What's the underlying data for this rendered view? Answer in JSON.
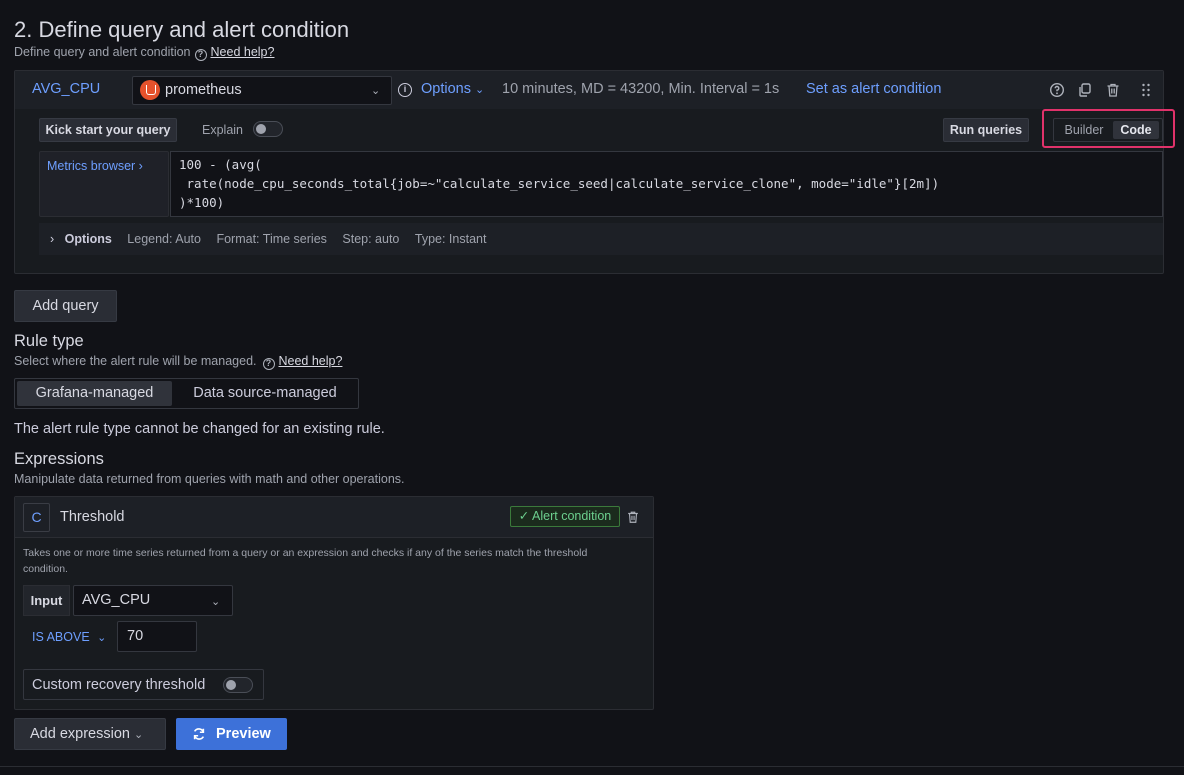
{
  "section": {
    "title": "2. Define query and alert condition",
    "subtitle": "Define query and alert condition",
    "help_link": "Need help?"
  },
  "query": {
    "ref_id": "AVG_CPU",
    "datasource": "prometheus",
    "options_label": "Options",
    "info": "10 minutes, MD = 43200, Min. Interval = 1s",
    "set_alert_condition": "Set as alert condition",
    "kick_start": "Kick start your query",
    "explain_label": "Explain",
    "run_queries": "Run queries",
    "mode_builder": "Builder",
    "mode_code": "Code",
    "metrics_browser": "Metrics browser ›",
    "code_lines": [
      "100 - (avg(",
      " rate(node_cpu_seconds_total{job=~\"calculate_service_seed|calculate_service_clone\", mode=\"idle\"}[2m])",
      ")*100)"
    ],
    "options_row": {
      "label": "Options",
      "legend": "Legend: Auto",
      "format": "Format: Time series",
      "step": "Step: auto",
      "type": "Type: Instant"
    }
  },
  "add_query": "Add query",
  "rule_type": {
    "title": "Rule type",
    "subtitle": "Select where the alert rule will be managed.",
    "help_link": "Need help?",
    "options": [
      "Grafana-managed",
      "Data source-managed"
    ],
    "selected": "Grafana-managed",
    "note": "The alert rule type cannot be changed for an existing rule."
  },
  "expressions": {
    "title": "Expressions",
    "subtitle": "Manipulate data returned from queries with math and other operations.",
    "card": {
      "ref_id": "C",
      "title": "Threshold",
      "badge": "✓ Alert condition",
      "description": "Takes one or more time series returned from a query or an expression and checks if any of the series match the threshold condition.",
      "input_label": "Input",
      "input_value": "AVG_CPU",
      "operator": "IS ABOVE",
      "threshold": "70",
      "custom_recovery": "Custom recovery threshold"
    }
  },
  "buttons": {
    "add_expression": "Add expression",
    "preview": "Preview"
  },
  "colors": {
    "accent": "#6e9fff",
    "primary_button": "#3d71d9",
    "highlight": "#e0326a",
    "prometheus": "#e6522c"
  }
}
